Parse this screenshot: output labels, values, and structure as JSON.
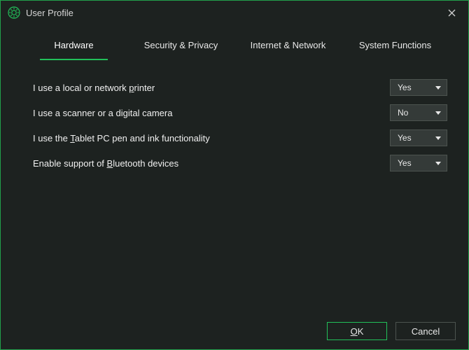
{
  "window": {
    "title": "User Profile",
    "icon": "gear-icon"
  },
  "tabs": [
    {
      "label": "Hardware",
      "active": true
    },
    {
      "label": "Security & Privacy",
      "active": false
    },
    {
      "label": "Internet & Network",
      "active": false
    },
    {
      "label": "System Functions",
      "active": false
    }
  ],
  "settings": [
    {
      "label_pre": "I use a local or network ",
      "mnemonic": "p",
      "label_post": "rinter",
      "value": "Yes"
    },
    {
      "label_pre": "I use a scanner or a digital camera",
      "mnemonic": "",
      "label_post": "",
      "value": "No"
    },
    {
      "label_pre": "I use the ",
      "mnemonic": "T",
      "label_post": "ablet PC pen and ink functionality",
      "value": "Yes"
    },
    {
      "label_pre": "Enable support of ",
      "mnemonic": "B",
      "label_post": "luetooth devices",
      "value": "Yes"
    }
  ],
  "select_options": [
    "Yes",
    "No"
  ],
  "buttons": {
    "ok_pre": "",
    "ok_mn": "O",
    "ok_post": "K",
    "cancel": "Cancel"
  },
  "colors": {
    "accent": "#22c05a",
    "bg": "#1d2220",
    "control": "#343a38"
  }
}
